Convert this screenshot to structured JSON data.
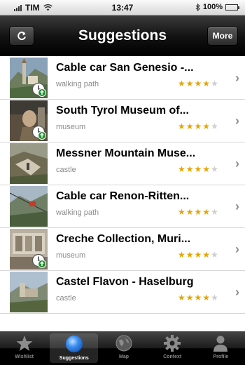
{
  "status_bar": {
    "carrier": "TIM",
    "time": "13:47",
    "battery": "100%",
    "battery_level": 1.0
  },
  "nav": {
    "title": "Suggestions",
    "more_label": "More"
  },
  "colors": {
    "star_on": "#e5a500",
    "star_off": "#cfcfcf",
    "badge_green": "#1e8f2e"
  },
  "items": [
    {
      "title": "Cable car San Genesio -...",
      "category": "walking path",
      "rating": 4,
      "max_rating": 5,
      "badge": "clock-up-icon"
    },
    {
      "title": "South Tyrol Museum of...",
      "category": "museum",
      "rating": 4,
      "max_rating": 5,
      "badge": "clock-up-icon"
    },
    {
      "title": "Messner Mountain Muse...",
      "category": "castle",
      "rating": 4,
      "max_rating": 5,
      "badge": ""
    },
    {
      "title": "Cable car Renon-Ritten...",
      "category": "walking path",
      "rating": 4,
      "max_rating": 5,
      "badge": ""
    },
    {
      "title": "Creche Collection, Muri...",
      "category": "museum",
      "rating": 4,
      "max_rating": 5,
      "badge": "clock-up-icon"
    },
    {
      "title": "Castel Flavon - Haselburg",
      "category": "castle",
      "rating": 4,
      "max_rating": 5,
      "badge": ""
    }
  ],
  "tabs": [
    {
      "label": "Wishlist",
      "icon": "star-icon",
      "active": false
    },
    {
      "label": "Suggestions",
      "icon": "bubble-icon",
      "active": true
    },
    {
      "label": "Map",
      "icon": "globe-icon",
      "active": false
    },
    {
      "label": "Context",
      "icon": "gear-icon",
      "active": false
    },
    {
      "label": "Profile",
      "icon": "person-icon",
      "active": false
    }
  ]
}
